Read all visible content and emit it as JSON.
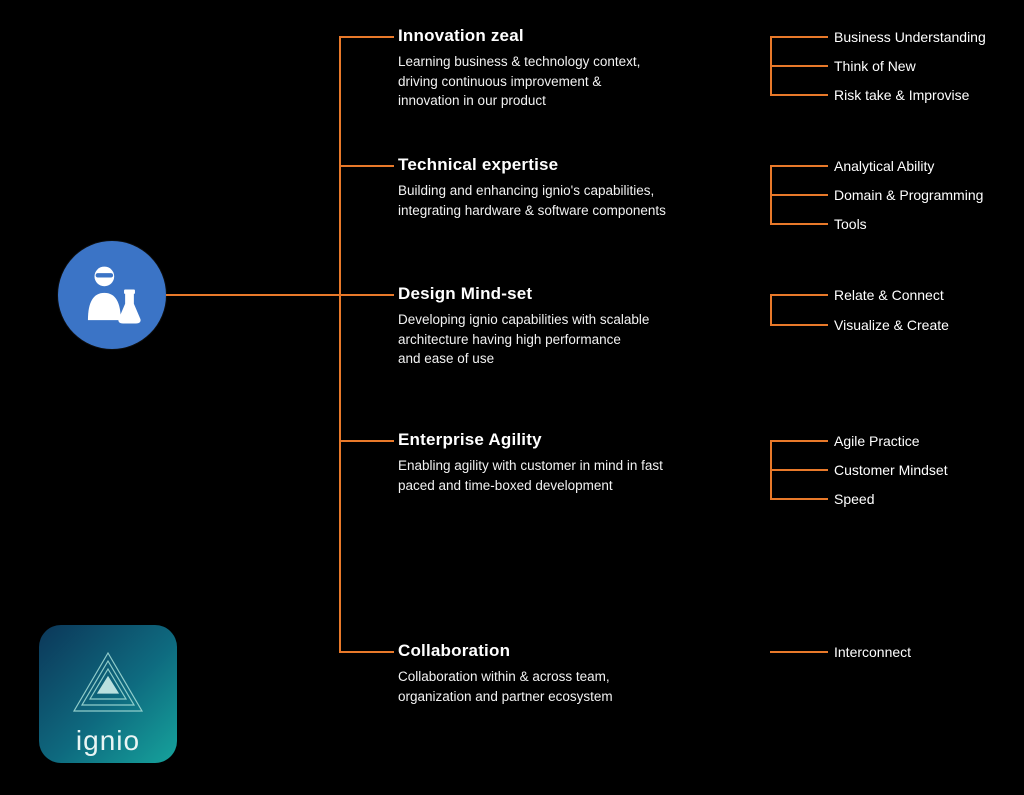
{
  "brand": "ignio",
  "colors": {
    "connector": "#e8792a",
    "root_icon_bg": "#3b74c6"
  },
  "root": {
    "icon": "scientist-icon"
  },
  "l1": [
    {
      "key": "innovation",
      "title": "Innovation zeal",
      "desc": "Learning business & technology context,\ndriving continuous improvement &\ninnovation in our product",
      "leaves": [
        "Business Understanding",
        "Think of New",
        "Risk take & Improvise"
      ]
    },
    {
      "key": "technical",
      "title": "Technical expertise",
      "desc": "Building and enhancing ignio's capabilities,\nintegrating hardware & software components",
      "leaves": [
        "Analytical Ability",
        "Domain & Programming",
        "Tools"
      ]
    },
    {
      "key": "design",
      "title": "Design Mind-set",
      "desc": "Developing ignio capabilities with scalable\narchitecture having high performance\nand ease of use",
      "leaves": [
        "Relate & Connect",
        "Visualize & Create"
      ]
    },
    {
      "key": "agility",
      "title": "Enterprise Agility",
      "desc": "Enabling agility with customer in mind in fast\npaced and time-boxed development",
      "leaves": [
        "Agile Practice",
        "Customer Mindset",
        "Speed"
      ]
    },
    {
      "key": "collaboration",
      "title": "Collaboration",
      "desc": "Collaboration within & across team,\norganization and partner ecosystem",
      "leaves": [
        "Interconnect"
      ]
    }
  ]
}
